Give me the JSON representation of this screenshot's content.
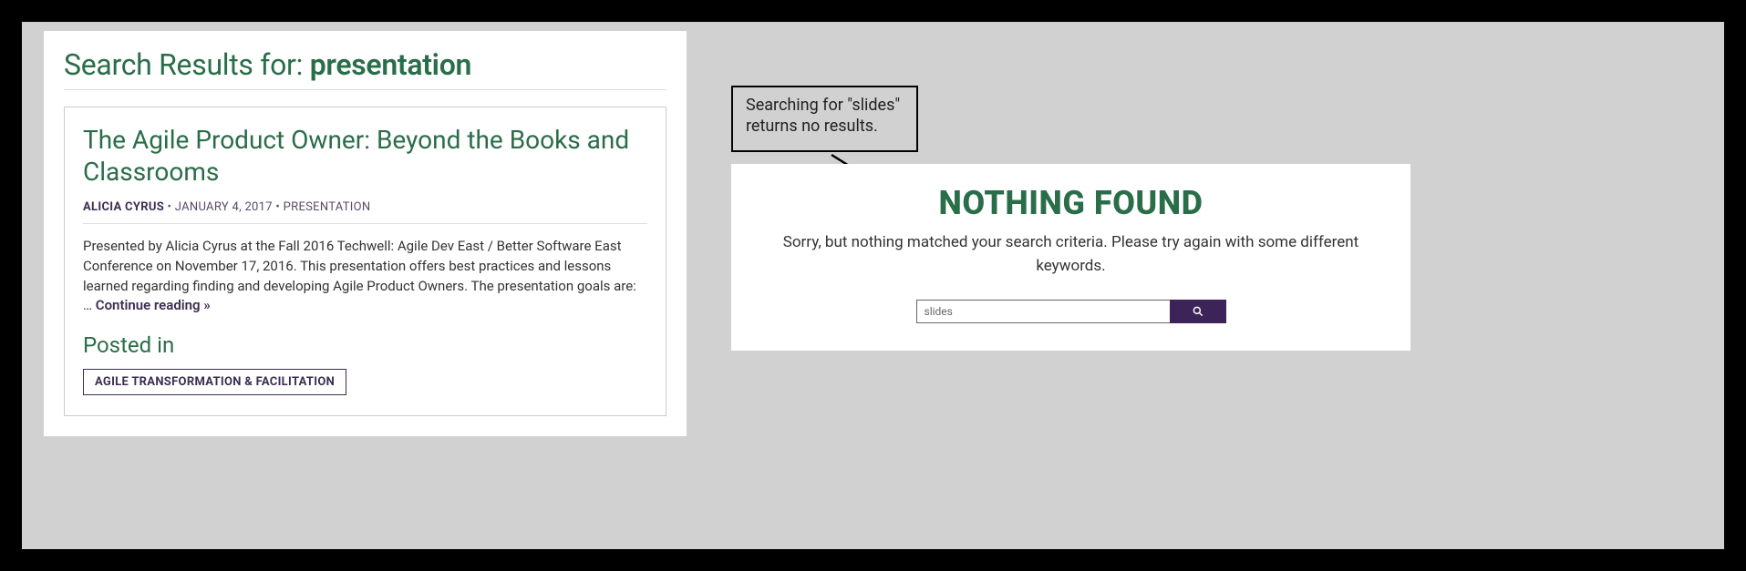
{
  "left": {
    "title_prefix": "Search Results for: ",
    "search_term": "presentation",
    "result": {
      "title": "The Agile Product Owner: Beyond the Books and Classrooms",
      "author": "ALICIA CYRUS",
      "sep1": " • ",
      "date": "JANUARY 4, 2017",
      "sep2": " • ",
      "category": "PRESENTATION",
      "excerpt": "Presented by Alicia Cyrus at the Fall 2016 Techwell: Agile Dev East / Better Software East Conference on November 17, 2016. This presentation offers best practices and lessons learned regarding finding and developing Agile Product Owners. The presentation goals are: … ",
      "continue": "Continue reading »",
      "posted_in_label": "Posted in",
      "tag": "AGILE TRANSFORMATION & FACILITATION"
    }
  },
  "annotation": {
    "text": "Searching for \"slides\" returns no results."
  },
  "right": {
    "heading": "NOTHING FOUND",
    "message": "Sorry, but nothing matched your search criteria. Please try again with some different keywords.",
    "search_value": "slides"
  }
}
